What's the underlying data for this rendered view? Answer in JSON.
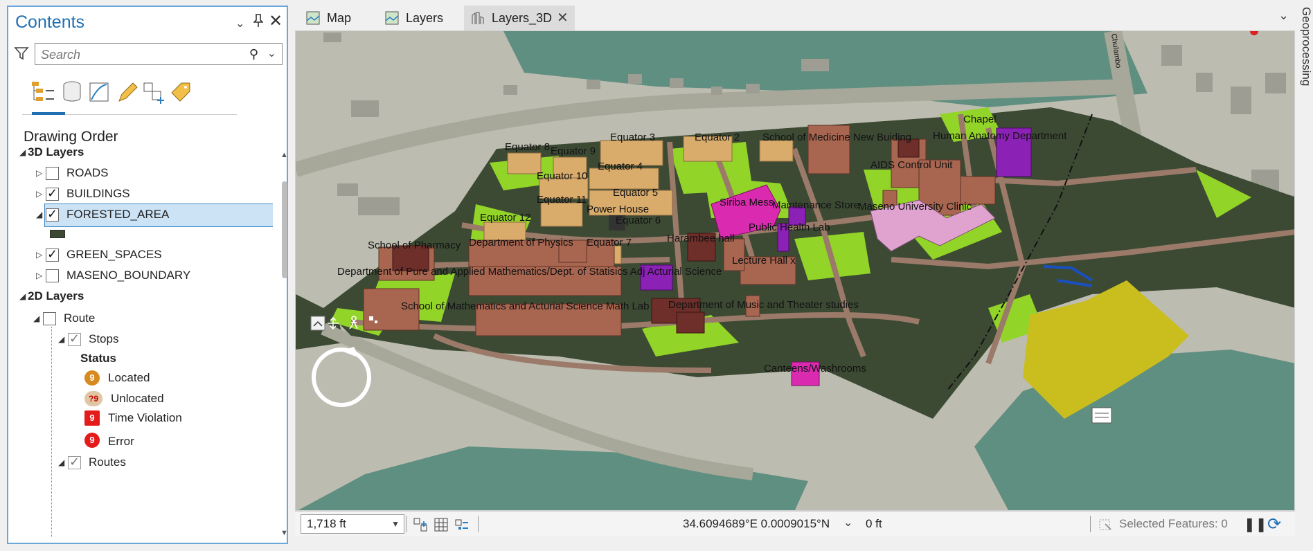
{
  "contents": {
    "title": "Contents",
    "search_placeholder": "Search",
    "section_title": "Drawing Order",
    "groups": [
      {
        "label": "3D Layers"
      },
      {
        "label": "2D Layers"
      }
    ],
    "layers_3d": [
      {
        "label": "ROADS",
        "checked": false
      },
      {
        "label": "BUILDINGS",
        "checked": true
      },
      {
        "label": "FORESTED_AREA",
        "checked": true,
        "selected": true
      },
      {
        "label": "GREEN_SPACES",
        "checked": true
      },
      {
        "label": "MASENO_BOUNDARY",
        "checked": false
      }
    ],
    "route": {
      "label": "Route",
      "stops_label": "Stops",
      "status_heading": "Status",
      "status_items": [
        {
          "label": "Located",
          "color": "#d88a1f",
          "symbol": "9"
        },
        {
          "label": "Unlocated",
          "color": "#e0c7a4",
          "symbol": "?9"
        },
        {
          "label": "Time Violation",
          "color": "#e41b1b",
          "symbol": "9"
        },
        {
          "label": "Error",
          "color": "#e41b1b",
          "symbol": "9"
        }
      ],
      "routes_label": "Routes"
    }
  },
  "tabs": [
    {
      "label": "Map",
      "active": false
    },
    {
      "label": "Layers",
      "active": false
    },
    {
      "label": "Layers_3D",
      "active": true
    }
  ],
  "map_labels": {
    "equator8": "Equator 8",
    "equator9": "Equator 9",
    "equator3": "Equator 3",
    "equator2": "Equator 2",
    "school_medicine": "School of Medicine New Buiding",
    "chapel": "Chapel",
    "human_anatomy": "Human Anatomy Department",
    "equator4": "Equator 4",
    "equator10": "Equator 10",
    "aids": "AIDS Control Unit",
    "equator5": "Equator 5",
    "equator11": "Equator 11",
    "siriba": "Siriba Mess",
    "maintenance": "Maintenance Store",
    "clinic": "Maseno University Clinic",
    "power": "Power House",
    "equator12": "Equator 12",
    "equator6": "Equator 6",
    "public_health": "Public Health Lab",
    "harambee": "Harambee hall",
    "pharmacy": "School of Pharmacy",
    "physics": "Department of Physics",
    "equator7": "Equator 7",
    "lecture_hall": "Lecture Hall x",
    "pure_math": "Department of Pure and Applied Mathematics/Dept. of Statisics Adj  Acturial Science",
    "math_lab": "School of Mathematics and Acturial Science Math Lab",
    "music": "Department of Music and Theater studies",
    "canteens": "Canteens/Washrooms",
    "road": "Chulambo"
  },
  "status": {
    "scale": "1,718 ft",
    "coordinates": "34.6094689°E 0.0009015°N",
    "elevation": "0 ft",
    "selected_features": "Selected Features: 0"
  },
  "side_tab": "Geoprocessing",
  "colors": {
    "accent": "#1f6fb2",
    "selection": "#cce3f5",
    "building_tan": "#d9ac6b",
    "building_brown": "#a86550",
    "building_purple": "#8b22b5",
    "building_magenta": "#d92ab0",
    "green_space": "#93d428",
    "forest": "#3c4a34",
    "water": "#5f8f80",
    "field_yellow": "#c9be1e"
  }
}
